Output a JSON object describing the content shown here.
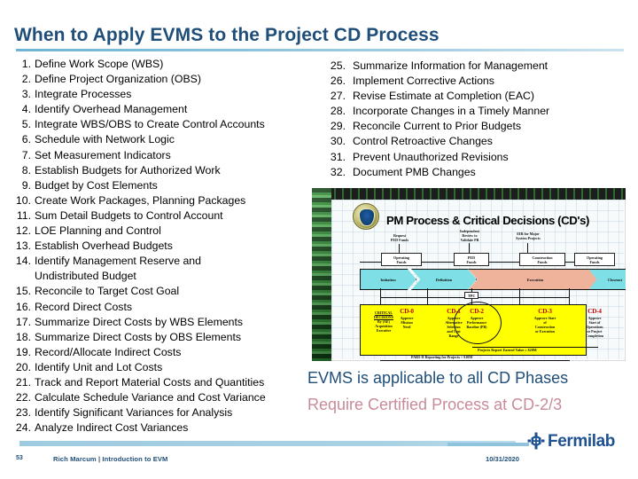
{
  "slide": {
    "title": "When to Apply EVMS to the Project CD Process",
    "left_list": [
      {
        "num": "1.",
        "text": "Define Work Scope (WBS)"
      },
      {
        "num": "2.",
        "text": "Define Project Organization (OBS)"
      },
      {
        "num": "3.",
        "text": "Integrate Processes"
      },
      {
        "num": "4.",
        "text": "Identify Overhead Management"
      },
      {
        "num": "5.",
        "text": "Integrate WBS/OBS to Create Control Accounts"
      },
      {
        "num": "6.",
        "text": "Schedule with Network Logic"
      },
      {
        "num": "7.",
        "text": "Set Measurement Indicators"
      },
      {
        "num": "8.",
        "text": "Establish Budgets for Authorized Work"
      },
      {
        "num": "9.",
        "text": "Budget by Cost Elements"
      },
      {
        "num": "10.",
        "text": "Create Work Packages, Planning Packages"
      },
      {
        "num": "11.",
        "text": "Sum Detail Budgets to Control Account"
      },
      {
        "num": "12.",
        "text": "LOE Planning and Control"
      },
      {
        "num": "13.",
        "text": "Establish Overhead Budgets"
      },
      {
        "num": "14.",
        "text": "Identify Management Reserve and"
      },
      {
        "num": "",
        "text": "Undistributed Budget",
        "continuation": true
      },
      {
        "num": "15.",
        "text": "Reconcile to Target Cost Goal"
      },
      {
        "num": "16.",
        "text": "Record Direct Costs"
      },
      {
        "num": "17.",
        "text": "Summarize Direct Costs by WBS Elements"
      },
      {
        "num": "18.",
        "text": "Summarize Direct Costs by OBS Elements"
      },
      {
        "num": "19.",
        "text": "Record/Allocate Indirect Costs"
      },
      {
        "num": "20.",
        "text": "Identify Unit and Lot Costs"
      },
      {
        "num": "21.",
        "text": "Track and Report Material Costs and Quantities"
      },
      {
        "num": "22.",
        "text": "Calculate Schedule Variance and Cost Variance"
      },
      {
        "num": "23.",
        "text": "Identify Significant Variances for Analysis"
      },
      {
        "num": "24.",
        "text": "Analyze Indirect Cost Variances"
      }
    ],
    "right_list": [
      {
        "num": "25.",
        "text": "Summarize Information for Management"
      },
      {
        "num": "26.",
        "text": "Implement Corrective Actions"
      },
      {
        "num": "27.",
        "text": "Revise Estimate at Completion (EAC)"
      },
      {
        "num": "28.",
        "text": "Incorporate Changes in a Timely Manner"
      },
      {
        "num": "29.",
        "text": "Reconcile Current to Prior Budgets"
      },
      {
        "num": "30.",
        "text": "Control Retroactive Changes"
      },
      {
        "num": "31.",
        "text": "Prevent Unauthorized Revisions"
      },
      {
        "num": "32.",
        "text": "Document PMB Changes"
      }
    ],
    "emphasis": {
      "line1": "EVMS is applicable to all CD Phases",
      "line2": "Require Certified Process at CD-2/3",
      "line1_color": "#1F4E79",
      "line2_color": "#C98B99"
    }
  },
  "diagram": {
    "title": "PM Process & Critical Decisions (CD's)",
    "seal_label": "doe-seal",
    "top_notes": [
      "Request\nPED Funds",
      "Independent\nReview to\nValidate PB",
      "EIR for Major\nSystem Projects"
    ],
    "funding_boxes": [
      "Operating\nFunds",
      "PED\nFunds",
      "Construction\nFunds",
      "Operating\nFunds"
    ],
    "phases": [
      {
        "label": "Initiation",
        "color": "#7EE0E6"
      },
      {
        "label": "Definition",
        "color": "#7EE0E6"
      },
      {
        "label": "Execution",
        "color": "#EFB39C"
      },
      {
        "label": "Closeout",
        "color": "#7EE0E6"
      }
    ],
    "tpc_label": "TPC",
    "critical_decisions_header": "CRITICAL DECISIONS By (AE) Acquisition Executive",
    "cds": [
      {
        "code": "CD-0",
        "desc": "Approve\nMission\nNeed"
      },
      {
        "code": "CD-1",
        "desc": "Approve\nAlternative\nSelection\nand Cost\nRange"
      },
      {
        "code": "CD-2",
        "desc": "Approve\nPerformance\nBaseline (PB)"
      },
      {
        "code": "CD-3",
        "desc": "Approve Start\nof\nConstruction\nor Execution"
      },
      {
        "code": "CD-4",
        "desc": "Approve\nStart of\nOperations\nor Project\nCompletion"
      }
    ],
    "captions": [
      "Projects Report Earned Value ≥ $20M",
      "PARS II Reporting for Projects > $10M"
    ],
    "cd_code_color": "#C00000",
    "yellow_fill": "#FFFF00"
  },
  "footer": {
    "slide_number": "53",
    "presenter_line": "Rich Marcum | Introduction to EVM",
    "date": "10/31/2020",
    "brand_name": "Fermilab",
    "brand_mark": "fermilab-logo-icon",
    "brand_color": "#1D5191",
    "rule_color": "#9FCBE0"
  }
}
